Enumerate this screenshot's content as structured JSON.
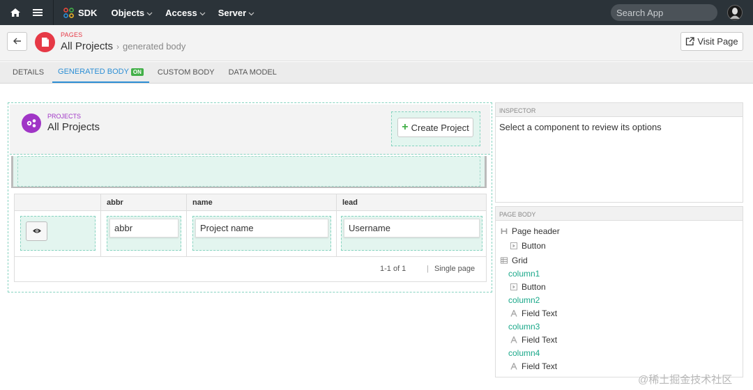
{
  "nav": {
    "brand": "SDK",
    "menu": [
      "Objects",
      "Access",
      "Server"
    ],
    "search_placeholder": "Search App"
  },
  "header": {
    "section": "PAGES",
    "title": "All Projects",
    "subtitle": "generated body",
    "visit_label": "Visit Page"
  },
  "tabs": [
    {
      "label": "DETAILS"
    },
    {
      "label": "GENERATED BODY",
      "badge": "ON",
      "active": true
    },
    {
      "label": "CUSTOM BODY"
    },
    {
      "label": "DATA MODEL"
    }
  ],
  "canvas": {
    "section": "PROJECTS",
    "title": "All Projects",
    "create_label": "Create Project",
    "grid": {
      "columns": [
        "abbr",
        "name",
        "lead"
      ],
      "fields": [
        "abbr",
        "Project name",
        "Username"
      ],
      "pager": "1-1 of 1",
      "pager_sep": "|",
      "pager_mode": "Single page"
    }
  },
  "inspector": {
    "heading": "INSPECTOR",
    "message": "Select a component to review its options"
  },
  "page_body": {
    "heading": "PAGE BODY",
    "nodes": [
      {
        "label": "Page header",
        "icon": "header-icon"
      },
      {
        "label": "Button",
        "icon": "button-icon"
      },
      {
        "label": "Grid",
        "icon": "grid-icon"
      },
      {
        "label": "column1"
      },
      {
        "label": "Button",
        "icon": "button-icon"
      },
      {
        "label": "column2"
      },
      {
        "label": "Field Text",
        "icon": "text-icon"
      },
      {
        "label": "column3"
      },
      {
        "label": "Field Text",
        "icon": "text-icon"
      },
      {
        "label": "column4"
      },
      {
        "label": "Field Text",
        "icon": "text-icon"
      }
    ]
  },
  "watermark": "@稀土掘金技术社区",
  "colors": {
    "nav_bg": "#2b3339",
    "accent_blue": "#2d8fd5",
    "page_red": "#e63946",
    "project_purple": "#a035c6",
    "drop_green": "#e3f5ef",
    "column_teal": "#1ba88a",
    "on_badge": "#43b049"
  }
}
